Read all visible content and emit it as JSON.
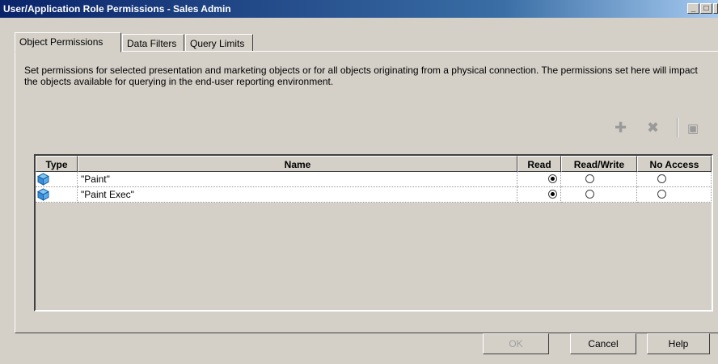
{
  "window": {
    "title": "User/Application Role Permissions - Sales Admin"
  },
  "tabs": [
    {
      "label": "Object Permissions",
      "active": true
    },
    {
      "label": "Data Filters",
      "active": false
    },
    {
      "label": "Query Limits",
      "active": false
    }
  ],
  "description": "Set permissions for selected presentation and marketing objects or for all objects originating from a physical connection. The permissions set here will impact the objects available for querying in the end-user reporting environment.",
  "toolbar": {
    "icons": [
      "add-icon",
      "delete-icon",
      "browse-icon"
    ]
  },
  "grid": {
    "columns": [
      "Type",
      "Name",
      "Read",
      "Read/Write",
      "No Access"
    ],
    "rows": [
      {
        "name": "\"Paint\"",
        "permission": "Read"
      },
      {
        "name": "\"Paint Exec\"",
        "permission": "Read"
      }
    ]
  },
  "buttons": {
    "ok": "OK",
    "cancel": "Cancel",
    "help": "Help"
  }
}
